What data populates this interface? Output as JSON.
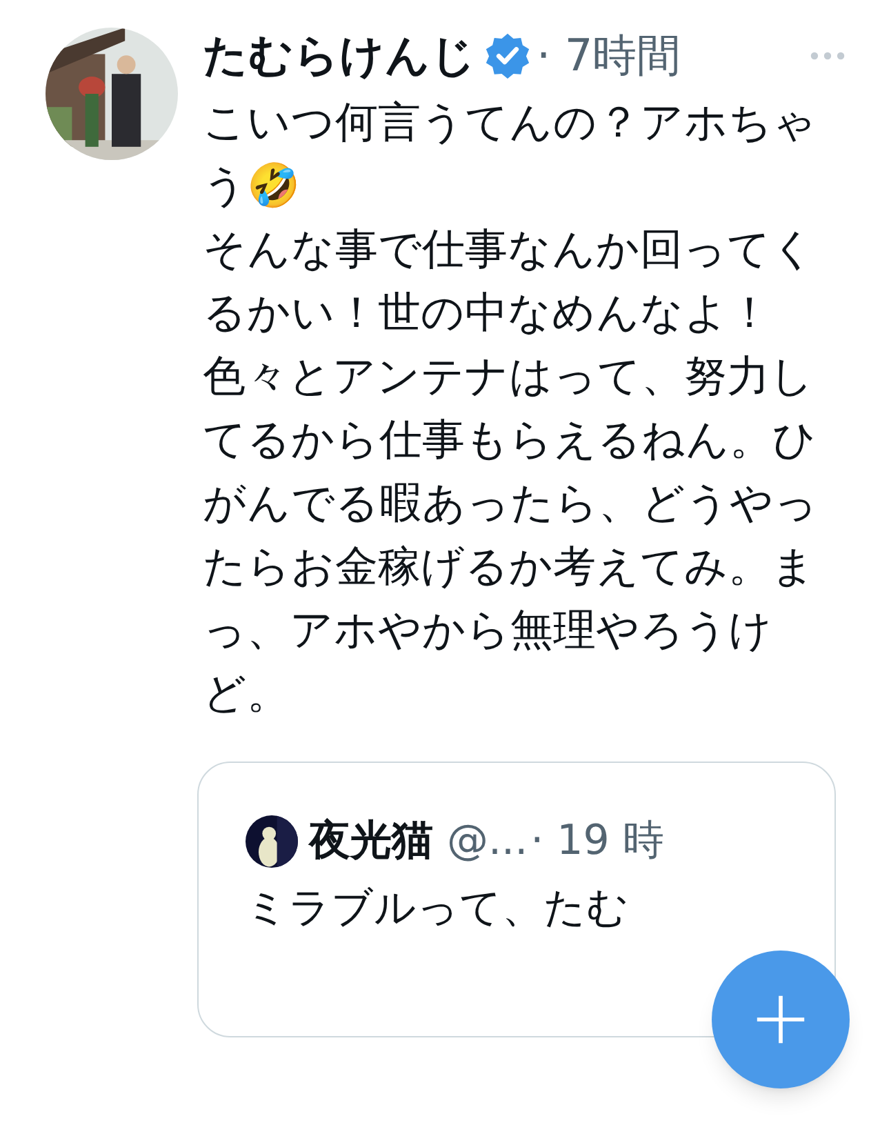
{
  "tweet": {
    "name": "たむらけんじ",
    "verified": true,
    "time": "· 7時間",
    "text": "こいつ何言うてんの？アホちゃう🤣\nそんな事で仕事なんか回ってくるかい！世の中なめんなよ！色々とアンテナはって、努力してるから仕事もらえるねん。ひがんでる暇あったら、どうやったらお金稼げるか考えてみ。まっ、アホやから無理やろうけど。"
  },
  "quoted": {
    "name": "夜光猫",
    "handle": "@...",
    "time": "· 19 時",
    "text": "ミラブルって、たむ"
  }
}
